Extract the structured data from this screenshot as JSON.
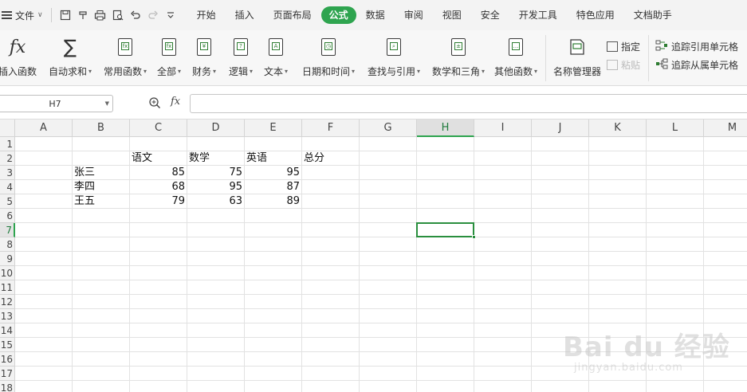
{
  "menubar": {
    "file_label": "文件",
    "tabs": [
      "开始",
      "插入",
      "页面布局",
      "公式",
      "数据",
      "审阅",
      "视图",
      "安全",
      "开发工具",
      "特色应用",
      "文档助手"
    ],
    "active_tab_index": 3,
    "accent_color": "#2ea44f"
  },
  "ribbon": {
    "insert_function": "插入函数",
    "autosum": "自动求和",
    "common_functions": "常用函数",
    "all": "全部",
    "financial": "财务",
    "logical": "逻辑",
    "text": "文本",
    "datetime": "日期和时间",
    "lookup": "查找与引用",
    "math": "数学和三角",
    "other": "其他函数",
    "name_manager": "名称管理器",
    "specify": "指定",
    "paste": "粘贴",
    "trace_precedents": "追踪引用单元格",
    "trace_dependents": "追踪从属单元格",
    "fx_symbol": "fx",
    "sigma_symbol": "∑"
  },
  "formula_bar": {
    "name_box": "H7",
    "fx_label": "fx",
    "formula": ""
  },
  "grid": {
    "columns": [
      "A",
      "B",
      "C",
      "D",
      "E",
      "F",
      "G",
      "H",
      "I",
      "J",
      "K",
      "L",
      "M"
    ],
    "rows": [
      "1",
      "2",
      "3",
      "4",
      "5",
      "6",
      "7",
      "8",
      "9",
      "10",
      "11",
      "12",
      "13",
      "14",
      "15",
      "16",
      "17",
      "18"
    ],
    "active_cell": "H7",
    "cells": {
      "C2": "语文",
      "D2": "数学",
      "E2": "英语",
      "F2": "总分",
      "B3": "张三",
      "C3": "85",
      "D3": "75",
      "E3": "95",
      "B4": "李四",
      "C4": "68",
      "D4": "95",
      "E4": "87",
      "B5": "王五",
      "C5": "79",
      "D5": "63",
      "E5": "89"
    }
  },
  "watermark": {
    "text": "Bai du 经验",
    "url": "jingyan.baidu.com"
  }
}
